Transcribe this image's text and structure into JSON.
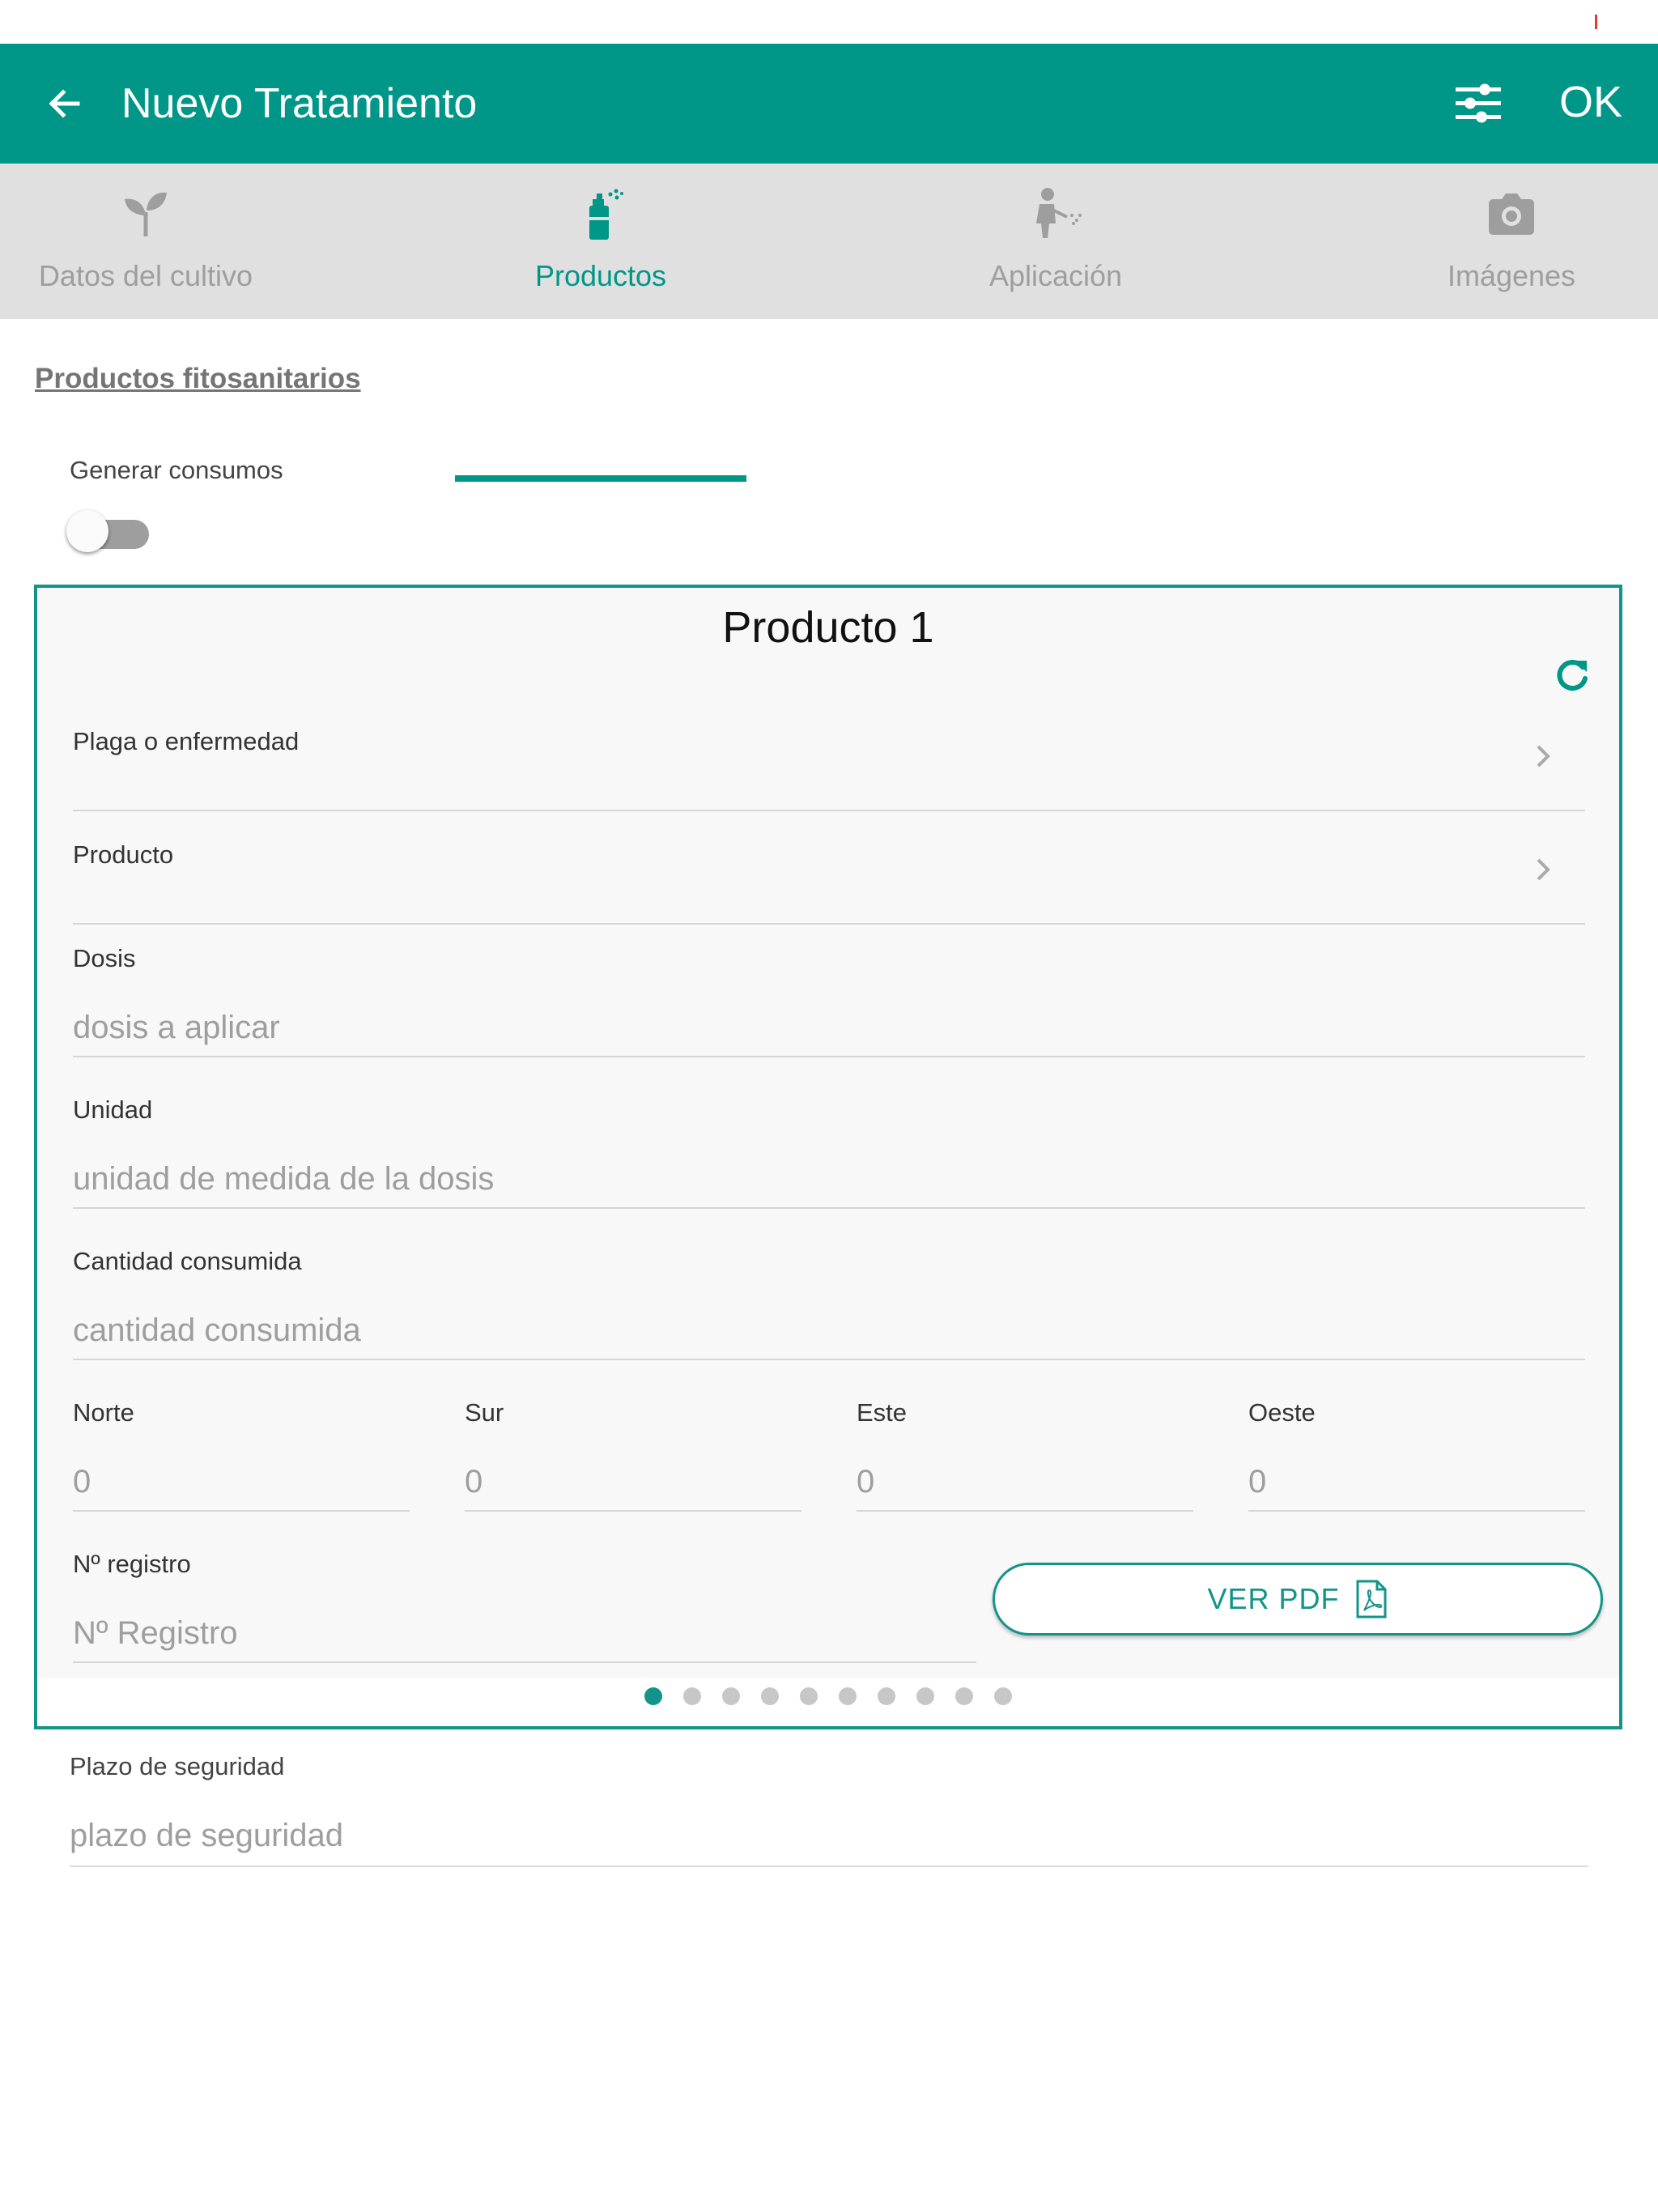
{
  "app_bar": {
    "title": "Nuevo Tratamiento",
    "back_icon": "arrow-left-icon",
    "filter_icon": "sliders-icon",
    "ok_label": "OK",
    "color": "#009688"
  },
  "tabs": [
    {
      "label": "Datos del cultivo",
      "icon": "sprout-icon",
      "active": false
    },
    {
      "label": "Productos",
      "icon": "spray-can-icon",
      "active": true
    },
    {
      "label": "Aplicación",
      "icon": "sprayer-person-icon",
      "active": false
    },
    {
      "label": "Imágenes",
      "icon": "camera-icon",
      "active": false
    }
  ],
  "section": {
    "title": "Productos fitosanitarios"
  },
  "generar_consumos": {
    "label": "Generar consumos",
    "enabled": false
  },
  "product_card": {
    "title": "Producto 1",
    "refresh_icon": "refresh-icon",
    "plaga": {
      "label": "Plaga o enfermedad"
    },
    "producto": {
      "label": "Producto"
    },
    "dosis": {
      "label": "Dosis",
      "placeholder": "dosis a aplicar"
    },
    "unidad": {
      "label": "Unidad",
      "placeholder": "unidad de medida de la dosis"
    },
    "cantidad": {
      "label": "Cantidad consumida",
      "placeholder": "cantidad consumida"
    },
    "orientation": [
      {
        "label": "Norte",
        "placeholder": "0"
      },
      {
        "label": "Sur",
        "placeholder": "0"
      },
      {
        "label": "Este",
        "placeholder": "0"
      },
      {
        "label": "Oeste",
        "placeholder": "0"
      }
    ],
    "registro": {
      "label": "Nº registro",
      "placeholder": "Nº Registro"
    },
    "pdf_button": {
      "label": "VER PDF",
      "icon": "pdf-file-icon"
    },
    "pager": {
      "total": 10,
      "active_index": 0
    }
  },
  "plazo": {
    "label": "Plazo de seguridad",
    "placeholder": "plazo de seguridad"
  },
  "colors": {
    "accent": "#009688",
    "card_border": "#13948a",
    "tab_bg": "#e0e0e0"
  }
}
